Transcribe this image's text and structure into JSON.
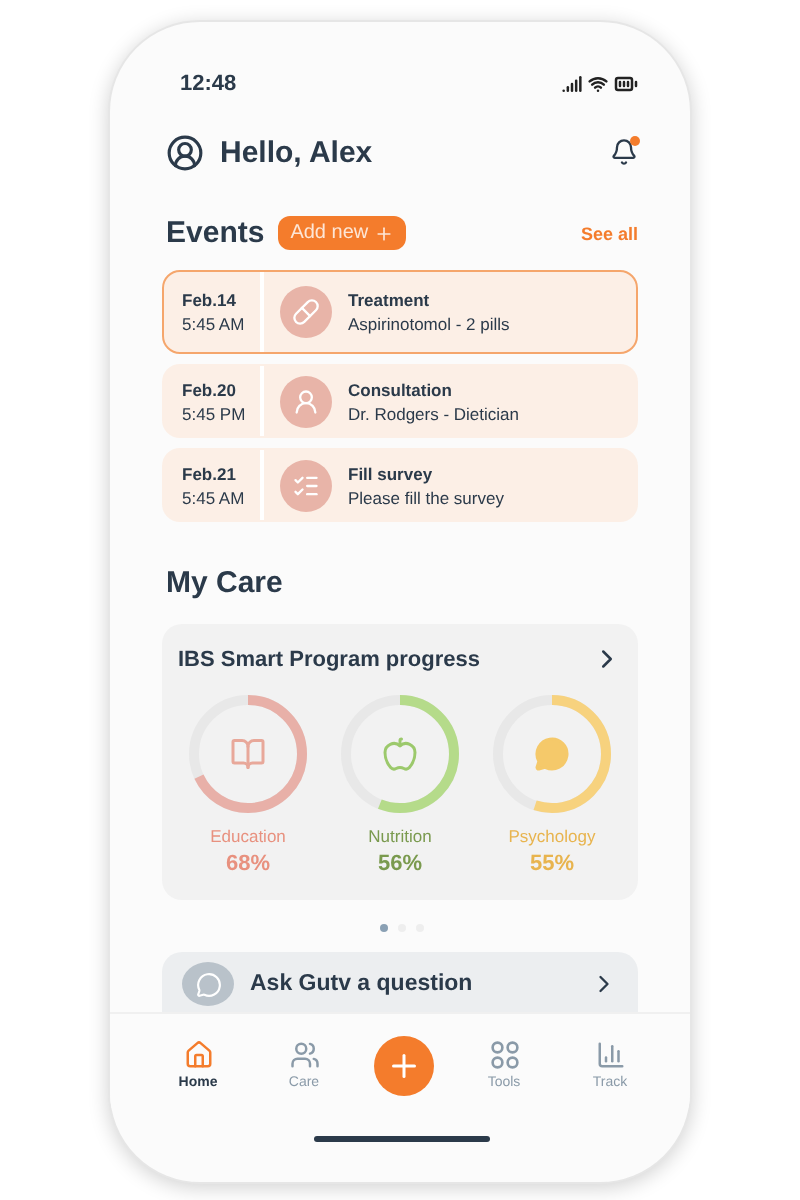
{
  "status_bar": {
    "time": "12:48"
  },
  "header": {
    "greeting": "Hello, Alex",
    "notification_badge": true
  },
  "events": {
    "title": "Events",
    "add_button": "Add new",
    "see_all": "See all",
    "items": [
      {
        "kind": "treatment",
        "date": "Feb.14",
        "time": "5:45 AM",
        "title": "Treatment",
        "detail": "Aspirinotomol - 2 pills",
        "selected": true
      },
      {
        "kind": "consultation",
        "date": "Feb.20",
        "time": "5:45 PM",
        "title": "Consultation",
        "detail": "Dr. Rodgers - Dietician",
        "selected": false
      },
      {
        "kind": "survey",
        "date": "Feb.21",
        "time": "5:45 AM",
        "title": "Fill survey",
        "detail": "Please fill the survey",
        "selected": false
      }
    ]
  },
  "my_care": {
    "title": "My Care",
    "program": {
      "title": "IBS Smart Program progress",
      "tracks": [
        {
          "kind": "education",
          "label": "Education",
          "percent": "68%",
          "level": 0.68,
          "color": "#e8917f"
        },
        {
          "kind": "nutrition",
          "label": "Nutrition",
          "percent": "56%",
          "level": 0.56,
          "color": "#7a9a4e"
        },
        {
          "kind": "psychology",
          "label": "Psychology",
          "percent": "55%",
          "level": 0.55,
          "color": "#e8b44e"
        }
      ]
    },
    "pages": [
      {
        "selected": true
      },
      {
        "selected": false
      },
      {
        "selected": false
      }
    ],
    "ask": {
      "label": "Ask Gutv a question"
    }
  },
  "tab_bar": [
    {
      "kind": "home",
      "label": "Home",
      "selected": true
    },
    {
      "kind": "care",
      "label": "Care",
      "selected": false
    },
    {
      "kind": "add",
      "selected": false
    },
    {
      "kind": "tools",
      "label": "Tools",
      "selected": false
    },
    {
      "kind": "track",
      "label": "Track",
      "selected": false
    }
  ]
}
